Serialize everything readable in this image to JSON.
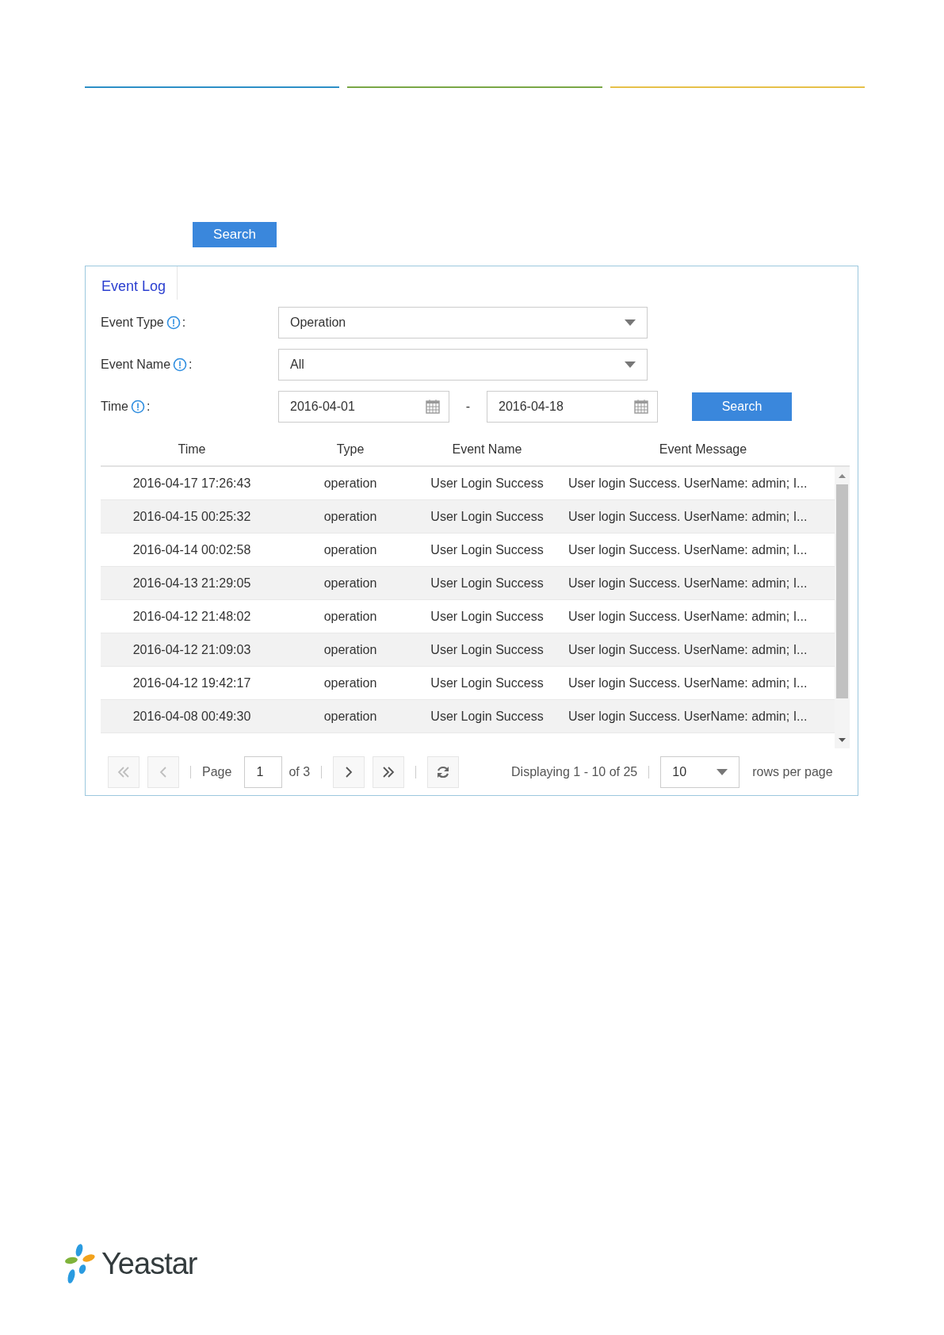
{
  "toolbar": {
    "search_button": "Search"
  },
  "panel": {
    "tabs": [
      {
        "label": "Event Log",
        "selected": true
      }
    ],
    "form": {
      "event_type": {
        "label": "Event Type",
        "colon": ":",
        "value": "Operation"
      },
      "event_name": {
        "label": "Event Name",
        "colon": ":",
        "value": "All"
      },
      "time": {
        "label": "Time",
        "colon": ":",
        "from": "2016-04-01",
        "separator": "-",
        "to": "2016-04-18"
      },
      "search_button": "Search"
    },
    "table": {
      "columns": [
        "Time",
        "Type",
        "Event Name",
        "Event Message"
      ],
      "rows": [
        [
          "2016-04-17 17:26:43",
          "operation",
          "User Login Success",
          "User login Success. UserName: admin; I..."
        ],
        [
          "2016-04-15 00:25:32",
          "operation",
          "User Login Success",
          "User login Success. UserName: admin; I..."
        ],
        [
          "2016-04-14 00:02:58",
          "operation",
          "User Login Success",
          "User login Success. UserName: admin; I..."
        ],
        [
          "2016-04-13 21:29:05",
          "operation",
          "User Login Success",
          "User login Success. UserName: admin; I..."
        ],
        [
          "2016-04-12 21:48:02",
          "operation",
          "User Login Success",
          "User login Success. UserName: admin; I..."
        ],
        [
          "2016-04-12 21:09:03",
          "operation",
          "User Login Success",
          "User login Success. UserName: admin; I..."
        ],
        [
          "2016-04-12 19:42:17",
          "operation",
          "User Login Success",
          "User login Success. UserName: admin; I..."
        ],
        [
          "2016-04-08 00:49:30",
          "operation",
          "User Login Success",
          "User login Success. UserName: admin; I..."
        ]
      ]
    },
    "pager": {
      "buttons_left": [
        {
          "kind": "first",
          "disabled": true
        },
        {
          "kind": "prev",
          "disabled": true
        }
      ],
      "page_label": "Page",
      "page": "1",
      "of": "of 3",
      "buttons_right": [
        {
          "kind": "next",
          "disabled": false
        },
        {
          "kind": "last",
          "disabled": false
        },
        {
          "kind": "refresh",
          "disabled": false
        }
      ],
      "displaying": "Displaying 1 - 10 of 25",
      "rows_per_page": "10",
      "rows_per_page_label": "rows per page"
    }
  },
  "footer": {
    "logo_text": "Yeastar"
  }
}
